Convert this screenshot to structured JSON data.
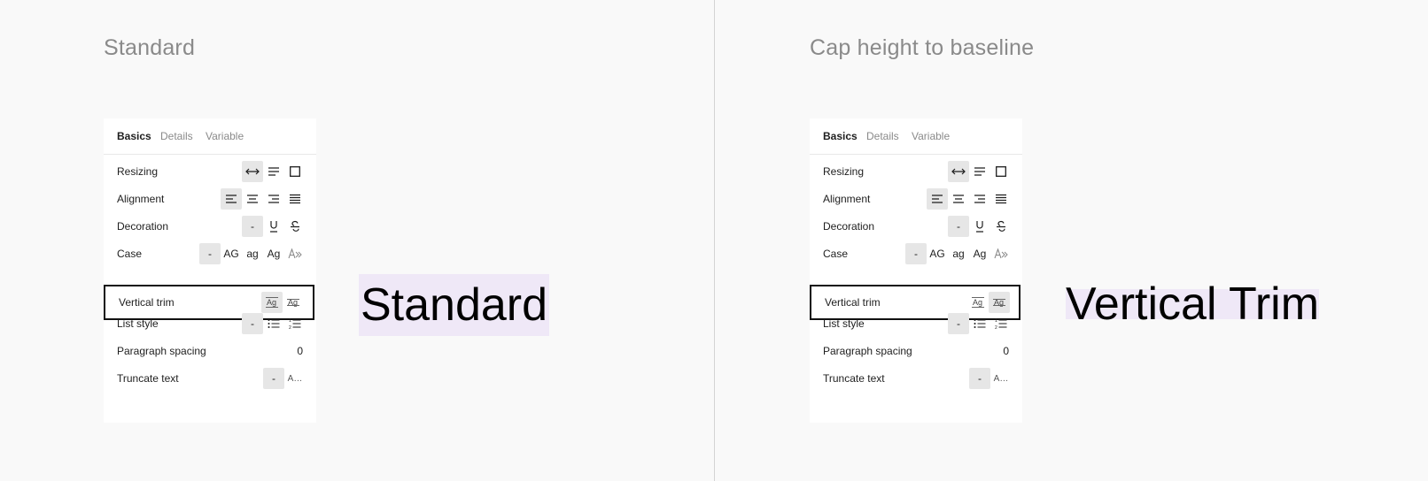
{
  "colors": {
    "background": "#f9f9f9",
    "panel": "#ffffff",
    "highlight": "#efe8f7",
    "active_control": "#e6e6e6",
    "outline": "#111111"
  },
  "left": {
    "title": "Standard",
    "tabs": [
      "Basics",
      "Details",
      "Variable"
    ],
    "rows": {
      "resizing": "Resizing",
      "alignment": "Alignment",
      "decoration": "Decoration",
      "case": "Case",
      "vertical_trim": "Vertical trim",
      "list_style": "List style",
      "paragraph_spacing": "Paragraph spacing",
      "truncate_text": "Truncate text"
    },
    "values": {
      "dash": "-",
      "case_upper": "AG",
      "case_lower": "ag",
      "case_title": "Ag",
      "trim_glyph": "Ag",
      "paragraph_spacing": "0",
      "truncate": "A…"
    },
    "selected_trim": "standard",
    "sample_text": "Standard"
  },
  "right": {
    "title": "Cap height to baseline",
    "tabs": [
      "Basics",
      "Details",
      "Variable"
    ],
    "rows": {
      "resizing": "Resizing",
      "alignment": "Alignment",
      "decoration": "Decoration",
      "case": "Case",
      "vertical_trim": "Vertical trim",
      "list_style": "List style",
      "paragraph_spacing": "Paragraph spacing",
      "truncate_text": "Truncate text"
    },
    "values": {
      "dash": "-",
      "case_upper": "AG",
      "case_lower": "ag",
      "case_title": "Ag",
      "trim_glyph": "Ag",
      "paragraph_spacing": "0",
      "truncate": "A…"
    },
    "selected_trim": "cap-height-to-baseline",
    "sample_text": "Vertical Trim"
  }
}
